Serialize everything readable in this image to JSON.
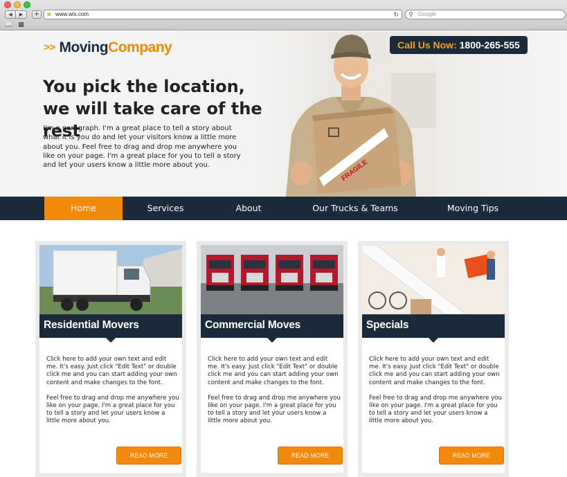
{
  "browser": {
    "url": "www.wix.com",
    "search_placeholder": "Google"
  },
  "colors": {
    "accent": "#f18a0b",
    "navy": "#1b2a3a"
  },
  "header": {
    "logo_part1": "Moving",
    "logo_part2": "Company",
    "call_label": "Call Us Now:",
    "call_number": "1800-265-555"
  },
  "hero": {
    "headline_line1": "You pick the location,",
    "headline_line2": "we will take care of the rest",
    "paragraph": "I'm a paragraph. I'm a great place to tell a story about what it is you do and let your visitors know a little more about you.  Feel free to drag and drop me anywhere you like on your page. I'm a great place for you to tell a story and let your users know a little more about you.",
    "box_label": "FRAGILE"
  },
  "nav": {
    "items": [
      {
        "label": "Home"
      },
      {
        "label": "Services"
      },
      {
        "label": "About"
      },
      {
        "label": "Our Trucks & Teams"
      },
      {
        "label": "Moving Tips"
      }
    ]
  },
  "cards": [
    {
      "title": "Residential Movers",
      "text1": "Click here to add your own text and edit me. It's easy. Just click \"Edit Text\" or double click me and you can start adding your own content and make changes to the font.",
      "text2": "Feel free to drag and drop me anywhere you like on your page. I'm a great place for you to tell a story and let your users know a little more about you.",
      "button": "READ MORE"
    },
    {
      "title": "Commercial Moves",
      "text1": "Click here to add your own text and edit me. It's easy. Just click \"Edit Text\" or double click me and you can start adding your own content and make changes to the font.",
      "text2": "Feel free to drag and drop me anywhere you like on your page. I'm a great place for you to tell a story and let your users know a little more about you.",
      "button": "READ MORE"
    },
    {
      "title": "Specials",
      "text1": "Click here to add your own text and edit me. It's easy. Just click \"Edit Text\" or double click me and you can start adding your own content and make changes to the font.",
      "text2": "Feel free to drag and drop me anywhere you like on your page. I'm a great place for you to tell a story and let your users know a little more about you.",
      "button": "READ MORE"
    }
  ]
}
